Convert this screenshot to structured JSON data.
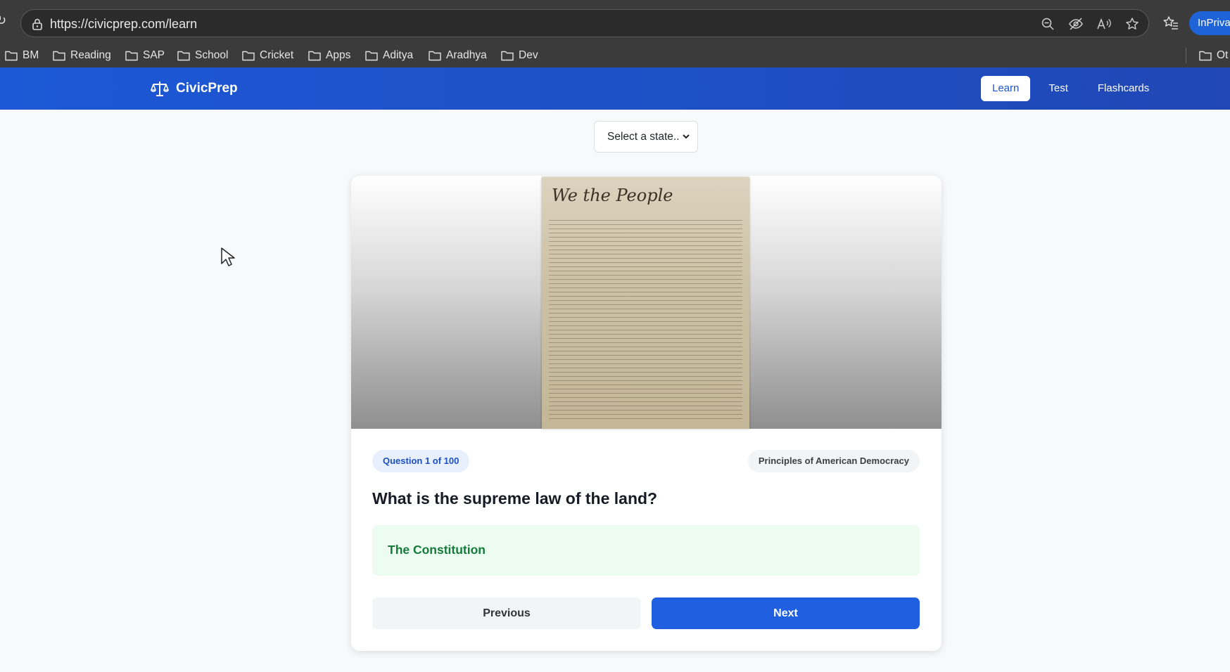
{
  "browser": {
    "url": "https://civicprep.com/learn",
    "bookmarks": [
      {
        "label": "BM"
      },
      {
        "label": "Reading"
      },
      {
        "label": "SAP"
      },
      {
        "label": "School"
      },
      {
        "label": "Cricket"
      },
      {
        "label": "Apps"
      },
      {
        "label": "Aditya"
      },
      {
        "label": "Aradhya"
      },
      {
        "label": "Dev"
      }
    ],
    "other_bookmarks": "Ot",
    "profile_label": "InPrivat",
    "address_icons": [
      "zoom-out-icon",
      "tracking-prevention-icon",
      "read-aloud-icon",
      "favorite-star-icon"
    ]
  },
  "navbar": {
    "brand": "CivicPrep",
    "links": [
      {
        "label": "Learn",
        "active": true
      },
      {
        "label": "Test",
        "active": false
      },
      {
        "label": "Flashcards",
        "active": false
      }
    ]
  },
  "state_select": {
    "selected": "Select a state.."
  },
  "card": {
    "image_heading": "We the People",
    "question_badge": "Question 1 of 100",
    "category_badge": "Principles of American Democracy",
    "question": "What is the supreme law of the land?",
    "answer": "The Constitution",
    "prev_label": "Previous",
    "next_label": "Next"
  },
  "colors": {
    "navbar": "#1e4fc4",
    "accent": "#1f5fe0",
    "answer_bg": "#ecfcf1",
    "answer_text": "#167a3a"
  }
}
